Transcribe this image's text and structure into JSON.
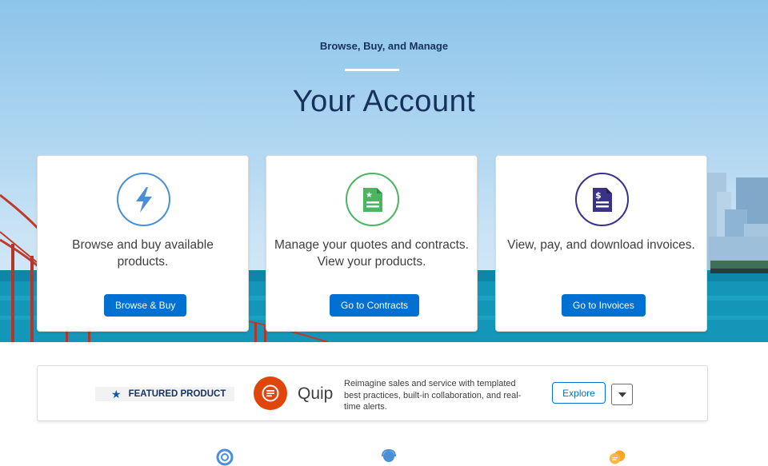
{
  "hero": {
    "eyebrow": "Browse, Buy, and Manage",
    "title": "Your Account"
  },
  "cards": [
    {
      "icon": "lightning-bolt-icon",
      "text": "Browse and buy available products.",
      "button": "Browse & Buy",
      "color": "#4a90d9"
    },
    {
      "icon": "contract-document-icon",
      "text": "Manage your quotes and contracts. View your products.",
      "button": "Go to Contracts",
      "color": "#4bb662"
    },
    {
      "icon": "invoice-document-icon",
      "text": "View, pay, and download invoices.",
      "button": "Go to Invoices",
      "color": "#3a3287"
    }
  ],
  "featured": {
    "badge": "FEATURED PRODUCT",
    "product_name": "Quip",
    "description": "Reimagine sales and service with templated best practices, built-in collaboration, and real-time alerts.",
    "explore_label": "Explore",
    "logo_color": "#e0450b"
  },
  "bottom_icons": [
    "lifebuoy-icon",
    "support-agent-icon",
    "chat-bubbles-icon"
  ],
  "colors": {
    "brand_blue": "#0070d2",
    "navy_text": "#16325c"
  }
}
